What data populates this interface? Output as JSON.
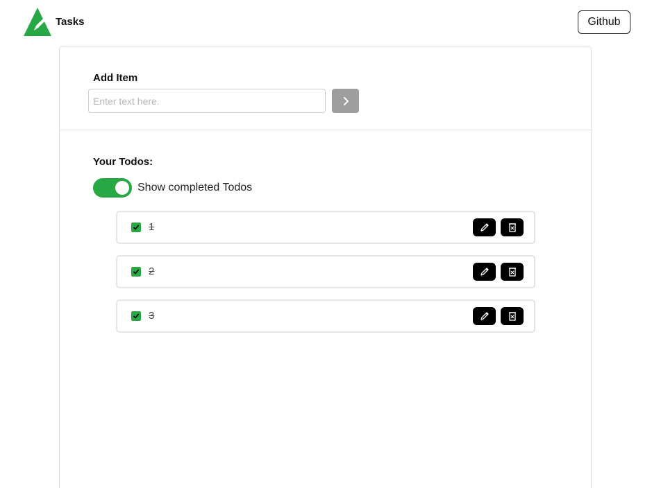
{
  "header": {
    "brand_name": "Tasks",
    "brand_color": "#28a745",
    "github_label": "Github"
  },
  "add_item": {
    "label": "Add Item",
    "input": {
      "value": "",
      "placeholder": "Enter text here."
    },
    "submit_icon": "chevron-right-icon",
    "submit_color": "#9e9e9e"
  },
  "todos": {
    "label": "Your Todos:",
    "toggle": {
      "label": "Show completed Todos",
      "on": true,
      "color": "#28a745"
    },
    "items": [
      {
        "text": "1",
        "completed": true
      },
      {
        "text": "2",
        "completed": true
      },
      {
        "text": "3",
        "completed": true
      }
    ],
    "edit_icon": "pencil-icon",
    "delete_icon": "trash-icon"
  }
}
